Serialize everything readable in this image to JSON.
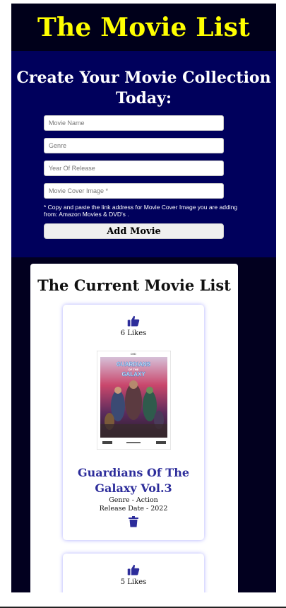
{
  "header": {
    "title": "The Movie List"
  },
  "form": {
    "title": "Create Your Movie Collection Today:",
    "name_placeholder": "Movie Name",
    "genre_placeholder": "Genre",
    "year_placeholder": "Year Of Release",
    "image_placeholder": "Movie Cover Image *",
    "note": "* Copy and paste the link address for Movie Cover Image you are adding from: Amazon Movies & DVD's .",
    "add_label": "Add Movie"
  },
  "list": {
    "title": "The Current Movie List",
    "movies": [
      {
        "likes": "6 Likes",
        "name": "Guardians Of The Galaxy Vol.3",
        "genre": "Genre - Action",
        "release": "Release Date - 2022",
        "poster": {
          "brand": "DVD",
          "title_line1": "GUARDIANS",
          "title_line2": "OF THE",
          "title_line3": "GALAXY"
        }
      },
      {
        "likes": "5 Likes"
      }
    ]
  },
  "colors": {
    "header_bg": "#00001a",
    "title_yellow": "#ffff00",
    "form_bg": "#00005c",
    "accent_blue": "#2d2d9b"
  },
  "icons": {
    "like": "thumbs-up-icon",
    "delete": "trash-icon"
  }
}
